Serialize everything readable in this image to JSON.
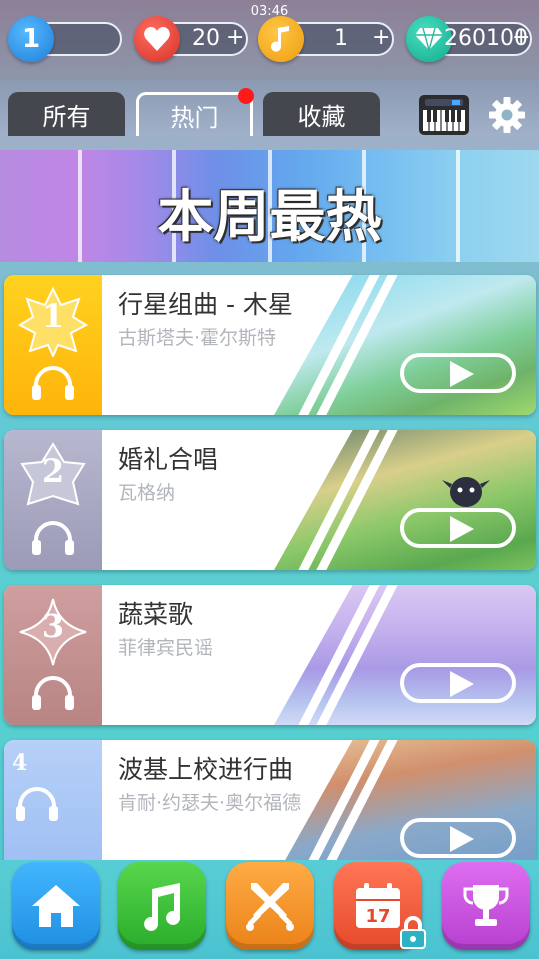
{
  "status": {
    "time": "03:46"
  },
  "topbar": {
    "level": "1",
    "lives": "20",
    "notes": "1",
    "gems": "260100",
    "plus": "+"
  },
  "tabs": [
    {
      "label": "所有",
      "active": false
    },
    {
      "label": "热门",
      "active": true,
      "has_notification": true
    },
    {
      "label": "收藏",
      "active": false
    }
  ],
  "banner": {
    "title": "本周最热"
  },
  "songs": [
    {
      "rank": "1",
      "title": "行星组曲 - 木星",
      "artist": "古斯塔夫·霍尔斯特",
      "rank_color": "#ffc61a"
    },
    {
      "rank": "2",
      "title": "婚礼合唱",
      "artist": "瓦格纳",
      "rank_color": "#a9a9c4"
    },
    {
      "rank": "3",
      "title": "蔬菜歌",
      "artist": "菲律宾民谣",
      "rank_color": "#c59596"
    },
    {
      "rank": "4",
      "title": "波基上校进行曲",
      "artist": "肯耐·约瑟夫·奥尔福德",
      "rank_color": "#a8c6f6"
    }
  ],
  "calendar": {
    "day": "17"
  },
  "icons": {
    "heart": "heart-icon",
    "note": "music-note-icon",
    "gem": "diamond-icon",
    "piano": "piano-icon",
    "settings": "gear-icon",
    "headphones": "headphones-icon",
    "home": "home-icon",
    "music": "music-icon",
    "battle": "crossed-swords-icon",
    "calendar": "calendar-icon",
    "trophy": "trophy-icon",
    "lock": "lock-icon"
  },
  "colors": {
    "heart": "#e8463b",
    "note": "#f5a623",
    "gem": "#21c7a8",
    "home": "#2fa3f0",
    "music": "#36c23a",
    "battle": "#f4922c",
    "calendar": "#ee5a34",
    "trophy": "#c94fd8",
    "notification": "#ff1a1a"
  }
}
